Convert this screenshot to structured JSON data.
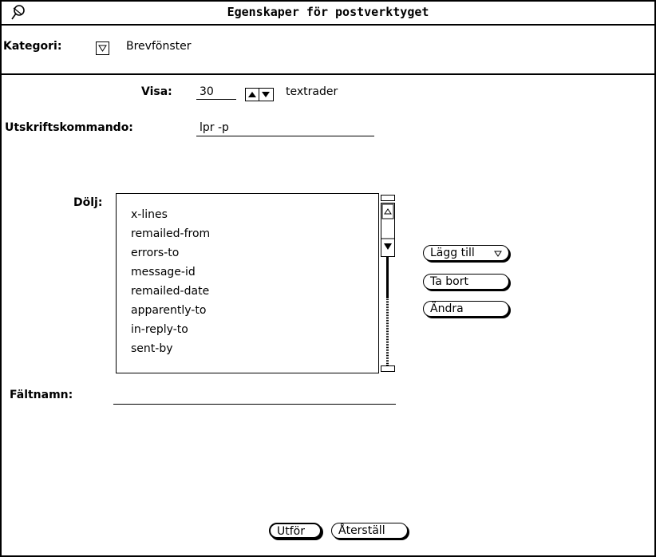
{
  "window": {
    "title": "Egenskaper för postverktyget",
    "menu_icon": "pushpin-icon"
  },
  "category": {
    "label": "Kategori:",
    "value": "Brevfönster",
    "menu_icon": "triangle-down-icon"
  },
  "display": {
    "label": "Visa:",
    "value": "30",
    "unit": "textrader",
    "stepper_icons": [
      "triangle-up-icon",
      "triangle-down-icon"
    ]
  },
  "print_command": {
    "label": "Utskriftskommando:",
    "value": "lpr -p"
  },
  "hide": {
    "label": "Dölj:",
    "items": [
      "x-lines",
      "remailed-from",
      "errors-to",
      "message-id",
      "remailed-date",
      "apparently-to",
      "in-reply-to",
      "sent-by"
    ]
  },
  "list_buttons": {
    "add": "Lägg till",
    "add_menu_icon": "triangle-down-icon",
    "remove": "Ta bort",
    "change": "Ändra"
  },
  "field_name": {
    "label": "Fältnamn:",
    "value": ""
  },
  "footer": {
    "apply": "Utför",
    "reset": "Återställ"
  }
}
